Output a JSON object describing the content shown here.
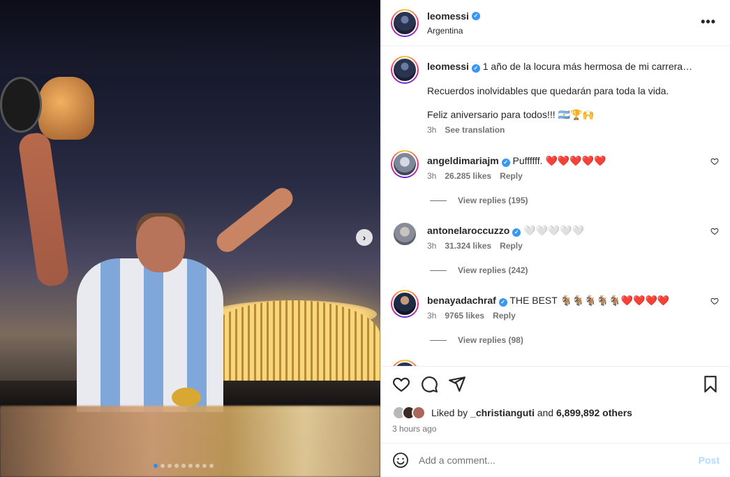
{
  "media": {
    "active_slide": 1,
    "slide_count": 9
  },
  "post": {
    "username": "leomessi",
    "location": "Argentina"
  },
  "caption": {
    "username": "leomessi",
    "line1": "1 año de la locura más hermosa de mi carrera…",
    "line2": "Recuerdos inolvidables que quedarán para toda la vida.",
    "line3": "Feliz aniversario para todos!!! 🇦🇷🏆🙌",
    "time": "3h",
    "see_translation": "See translation"
  },
  "comments": [
    {
      "username": "angeldimariajm",
      "text": "Puffffff. ❤️❤️❤️❤️❤️",
      "time": "3h",
      "likes": "26.285 likes",
      "reply": "Reply",
      "view_replies": "View replies (195)"
    },
    {
      "username": "antonelaroccuzzo",
      "text": "🤍🤍🤍🤍🤍",
      "time": "3h",
      "likes": "31.324 likes",
      "reply": "Reply",
      "view_replies": "View replies (242)"
    },
    {
      "username": "benayadachraf",
      "text": "THE BEST 🐐🐐🐐🐐🐐❤️❤️❤️❤️",
      "time": "3h",
      "likes": "9765 likes",
      "reply": "Reply",
      "view_replies": "View replies (98)"
    }
  ],
  "likes": {
    "prefix": "Liked by",
    "user": "_christianguti",
    "and": "and",
    "others": "6,899,892 others"
  },
  "time_ago": "3 hours ago",
  "add_comment": {
    "placeholder": "Add a comment...",
    "post_label": "Post"
  }
}
